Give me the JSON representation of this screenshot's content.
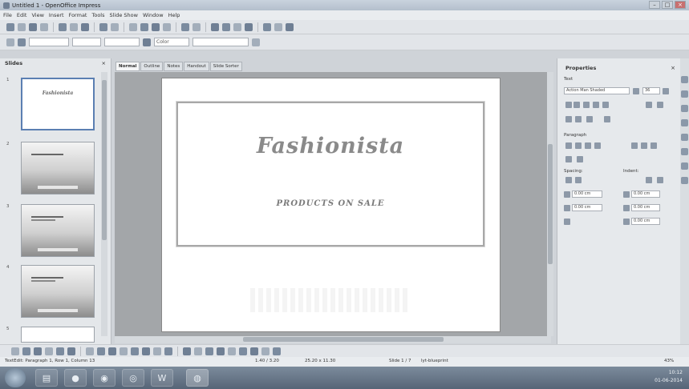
{
  "window": {
    "title": "Untitled 1 - OpenOffice Impress"
  },
  "menu": [
    "File",
    "Edit",
    "View",
    "Insert",
    "Format",
    "Tools",
    "Slide Show",
    "Window",
    "Help"
  ],
  "toolbar2": {
    "color_label": "Color"
  },
  "slides_panel": {
    "title": "Slides",
    "close": "×",
    "slide_numbers": [
      "1",
      "2",
      "3",
      "4",
      "5"
    ],
    "thumb1_title": "Fashionista"
  },
  "view_tabs": [
    "Normal",
    "Outline",
    "Notes",
    "Handout",
    "Slide Sorter"
  ],
  "slide": {
    "title": "Fashionista",
    "subtitle": "PRODUCTS ON SALE"
  },
  "properties": {
    "title": "Properties",
    "close": "×",
    "text_section": "Text",
    "font_name": "Action Man Shaded",
    "font_size": "36",
    "paragraph_section": "Paragraph",
    "spacing_label": "Spacing:",
    "indent_label": "Indent:",
    "spacing_above": "0.00 cm",
    "spacing_below": "0.00 cm",
    "indent_before": "0.00 cm",
    "indent_after": "0.00 cm",
    "indent_first": "0.00 cm"
  },
  "status": {
    "left": "TextEdit: Paragraph 1, Row 1, Column 13",
    "pos": "1.40 / 3.20",
    "size": "25.20 x 11.30",
    "slide": "Slide 1 / 7",
    "layout": "lyt-blueprint",
    "zoom": "43%"
  },
  "clock": {
    "time": "10:12",
    "date": "01-06-2014"
  }
}
